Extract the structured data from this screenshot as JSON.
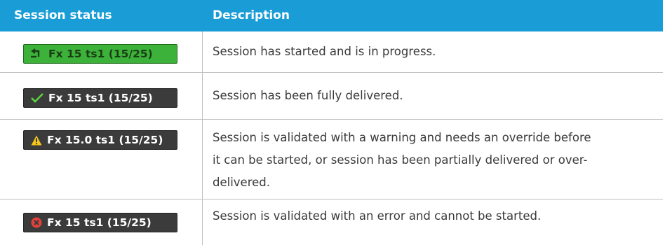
{
  "header": {
    "col_status": "Session status",
    "col_description": "Description"
  },
  "rows": [
    {
      "badge_text": "Fx 15 ts1 (15/25)",
      "icon": "in-progress-arrow-icon",
      "description_lines": [
        "Session has started and is in progress."
      ]
    },
    {
      "badge_text": "Fx 15 ts1 (15/25)",
      "icon": "checkmark-icon",
      "description_lines": [
        "Session has been fully delivered."
      ]
    },
    {
      "badge_text": "Fx 15.0 ts1 (15/25)",
      "icon": "warning-triangle-icon",
      "description_lines": [
        "Session is validated with a warning and needs an override before",
        "it can be started, or session has been partially delivered or over-",
        "delivered."
      ]
    },
    {
      "badge_text": "Fx 15 ts1 (15/25)",
      "icon": "error-circle-icon",
      "description_lines": [
        "Session is validated with an error and cannot be started."
      ]
    }
  ],
  "colors": {
    "header_bg": "#1a9dd7",
    "in_progress_green": "#3db23a",
    "badge_dark": "#3b3b3b",
    "check_green": "#5bd13f",
    "warning_yellow": "#f5c518",
    "error_red": "#e0413a"
  }
}
